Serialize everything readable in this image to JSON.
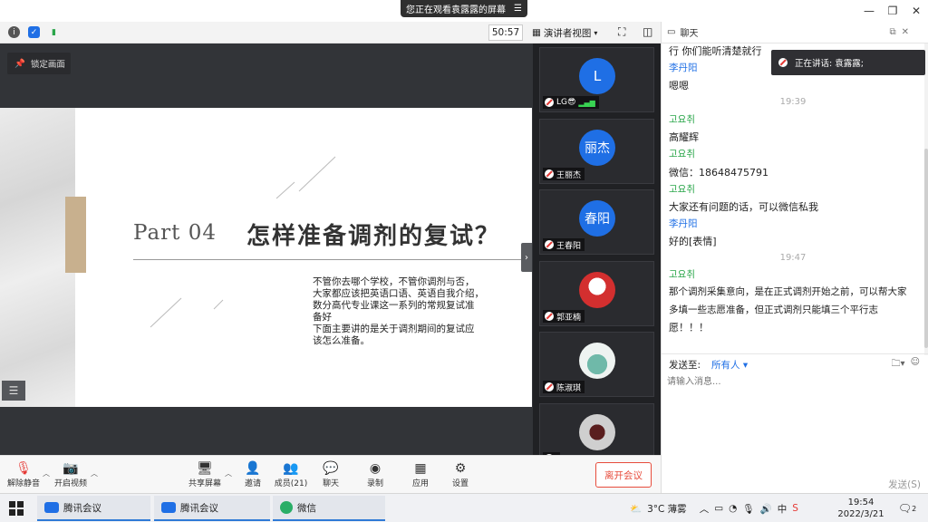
{
  "window": {
    "share_notice": "您正在观看袁露露的屏幕",
    "minimize": "—",
    "restore": "❐",
    "close": "✕"
  },
  "meeting_bar": {
    "timer": "50:57",
    "view_label": "演讲者视图"
  },
  "share": {
    "lock_label": "锁定画面",
    "slide": {
      "part_label": "Part 04",
      "title": "怎样准备调剂的复试？",
      "body": [
        "不管你去哪个学校，不管你调剂与否，",
        "大家都应该把英语口语、英语自我介绍，",
        "数分高代专业课这一系列的常规复试准",
        "备好",
        "下面主要讲的是关于调剂期间的复试应",
        "该怎么准备。"
      ]
    }
  },
  "participants": [
    {
      "avatar": "L",
      "name": "LG😎",
      "style": "blue"
    },
    {
      "avatar": "丽杰",
      "name": "王丽杰",
      "style": "blue"
    },
    {
      "avatar": "春阳",
      "name": "王春阳",
      "style": "blue"
    },
    {
      "avatar": "",
      "name": "郭亚楠",
      "style": "image-red"
    },
    {
      "avatar": "",
      "name": "陈淑琪",
      "style": "image-teal"
    },
    {
      "avatar": "",
      "name": "",
      "style": "image-dark"
    }
  ],
  "chat": {
    "title": "聊天",
    "speaker_label": "正在讲话: 袁露露;",
    "messages": [
      {
        "kind": "text",
        "text": "行 你们能听清楚就行"
      },
      {
        "kind": "sender",
        "text": "李丹阳"
      },
      {
        "kind": "text",
        "text": "嗯嗯"
      },
      {
        "kind": "time",
        "text": "19:39"
      },
      {
        "kind": "sender-kr",
        "text": "고요취"
      },
      {
        "kind": "text",
        "text": "高耀辉"
      },
      {
        "kind": "sender-kr",
        "text": "고요취"
      },
      {
        "kind": "text",
        "text": "微信：18648475791"
      },
      {
        "kind": "sender-kr",
        "text": "고요취"
      },
      {
        "kind": "text",
        "text": "大家还有问题的话，可以微信私我"
      },
      {
        "kind": "sender",
        "text": "李丹阳"
      },
      {
        "kind": "text",
        "text": "好的[表情]"
      },
      {
        "kind": "time",
        "text": "19:47"
      },
      {
        "kind": "sender-kr",
        "text": "고요취"
      },
      {
        "kind": "text",
        "text": "那个调剂采集意向，是在正式调剂开始之前，可以帮大家"
      },
      {
        "kind": "text",
        "text": "多填一些志愿准备，但正式调剂只能填三个平行志"
      },
      {
        "kind": "text",
        "text": "愿！！！"
      }
    ],
    "send_to_label": "发送至:",
    "send_to_value": "所有人 ▾",
    "input_placeholder": "请输入消息...",
    "send_button": "发送(S)"
  },
  "toolbar": {
    "mute": "解除静音",
    "video": "开启视频",
    "share_screen": "共享屏幕",
    "invite": "邀请",
    "members": "成员(21)",
    "chat": "聊天",
    "record": "录制",
    "apps": "应用",
    "settings": "设置",
    "leave": "离开会议"
  },
  "taskbar": {
    "tasks": [
      "腾讯会议",
      "腾讯会议",
      "微信"
    ],
    "weather": "3°C 薄雾",
    "time": "19:54",
    "date": "2022/3/21",
    "notifications": "2"
  },
  "colors": {
    "accent": "#1f6fe5",
    "leave": "#e74c3c",
    "slide_accent": "#c8b08e"
  }
}
